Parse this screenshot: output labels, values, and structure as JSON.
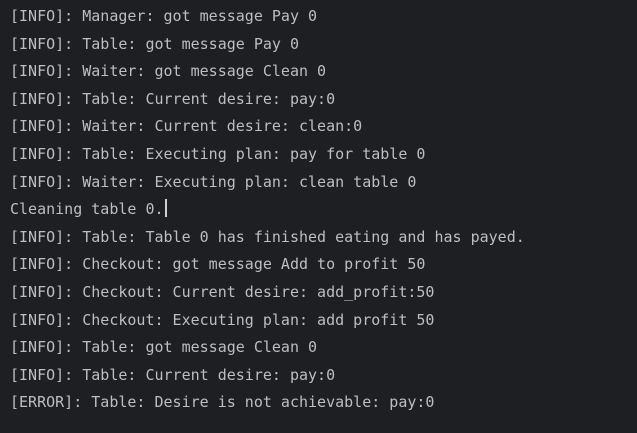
{
  "console": {
    "lines": [
      "[INFO]: Manager: got message Pay 0",
      "[INFO]: Table: got message Pay 0",
      "[INFO]: Waiter: got message Clean 0",
      "[INFO]: Table: Current desire: pay:0",
      "[INFO]: Waiter: Current desire: clean:0",
      "[INFO]: Table: Executing plan: pay for table 0",
      "[INFO]: Waiter: Executing plan: clean table 0",
      "Cleaning table 0.",
      "[INFO]: Table: Table 0 has finished eating and has payed.",
      "[INFO]: Checkout: got message Add to profit 50",
      "[INFO]: Checkout: Current desire: add_profit:50",
      "[INFO]: Checkout: Executing plan: add profit 50",
      "[INFO]: Table: got message Clean 0",
      "[INFO]: Table: Current desire: pay:0",
      "[ERROR]: Table: Desire is not achievable: pay:0"
    ]
  }
}
